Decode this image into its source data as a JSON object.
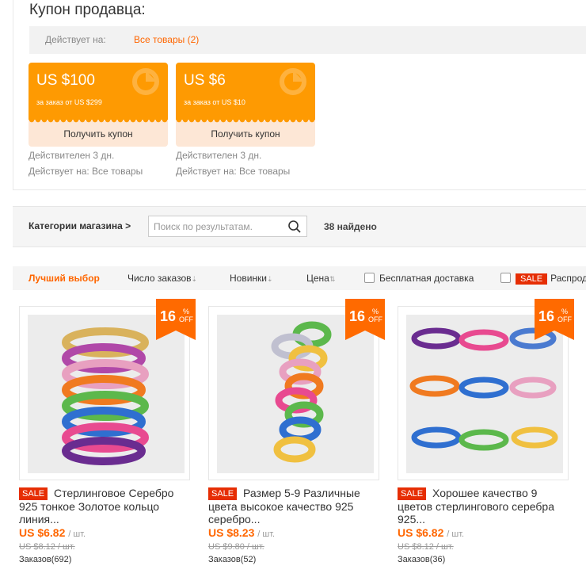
{
  "coupon_section": {
    "title": "Купон продавца:",
    "applies_label": "Действует на:",
    "applies_link": "Все товары (2)",
    "coupons": [
      {
        "amount": "US $100",
        "condition": "за заказ от US $299",
        "button": "Получить купон",
        "validity": "Действителен 3 дн.",
        "applies": "Действует на: Все товары"
      },
      {
        "amount": "US $6",
        "condition": "за заказ от US $10",
        "button": "Получить купон",
        "validity": "Действителен 3 дн.",
        "applies": "Действует на: Все товары"
      }
    ]
  },
  "store_bar": {
    "categories_label": "Категории магазина >",
    "search_placeholder": "Поиск по результатам.",
    "found_count": "38 найдено"
  },
  "sort_bar": {
    "best": "Лучший выбор",
    "orders": "Число заказов",
    "new": "Новинки",
    "price": "Цена",
    "free_shipping": "Бесплатная доставка",
    "sale_label": "SALE",
    "sale_text": "Распродажа"
  },
  "products": [
    {
      "discount": "16",
      "pct": "%",
      "off": "OFF",
      "sale": "SALE",
      "title": "Стерлинговое Серебро 925 тонкое Золотое кольцо линия...",
      "price": "US $6.82",
      "unit": "/ шт.",
      "old_price": "US $8.12 / шт.",
      "orders": "Заказов(692)"
    },
    {
      "discount": "16",
      "pct": "%",
      "off": "OFF",
      "sale": "SALE",
      "title": "Размер 5-9 Различные цвета высокое качество 925 серебро...",
      "price": "US $8.23",
      "unit": "/ шт.",
      "old_price": "US $9.80 / шт.",
      "orders": "Заказов(52)"
    },
    {
      "discount": "16",
      "pct": "%",
      "off": "OFF",
      "sale": "SALE",
      "title": "Хорошее качество 9 цветов стерлингового серебра 925...",
      "price": "US $6.82",
      "unit": "/ шт.",
      "old_price": "US $8.12 / шт.",
      "orders": "Заказов(36)"
    }
  ],
  "colors": {
    "accent": "#ff6600",
    "coupon": "#fe9a02",
    "sale": "#e62e04"
  }
}
